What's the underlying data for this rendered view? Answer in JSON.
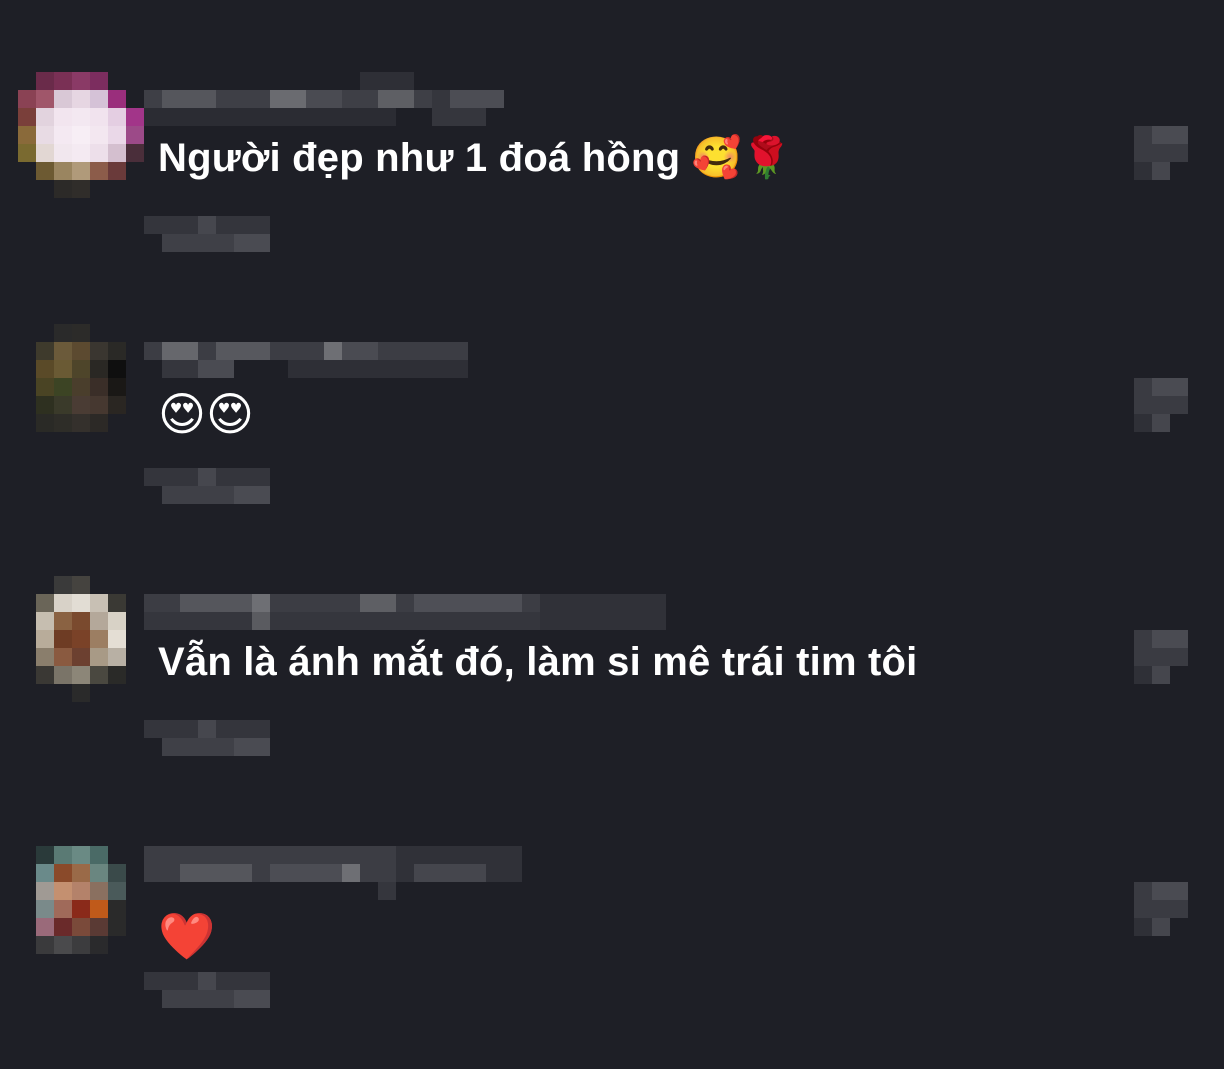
{
  "comments": [
    {
      "text": "Người đẹp như 1 đoá hồng 🥰🌹"
    },
    {
      "text": "😍😍"
    },
    {
      "text": "Vẫn là ánh mắt đó, làm si mê trái tim tôi"
    },
    {
      "text": "❤️"
    }
  ],
  "icons": {
    "avatar": "avatar-pixelated",
    "more": "more-options-icon"
  },
  "colors": {
    "background": "#1e1f26",
    "text": "#ffffff"
  }
}
